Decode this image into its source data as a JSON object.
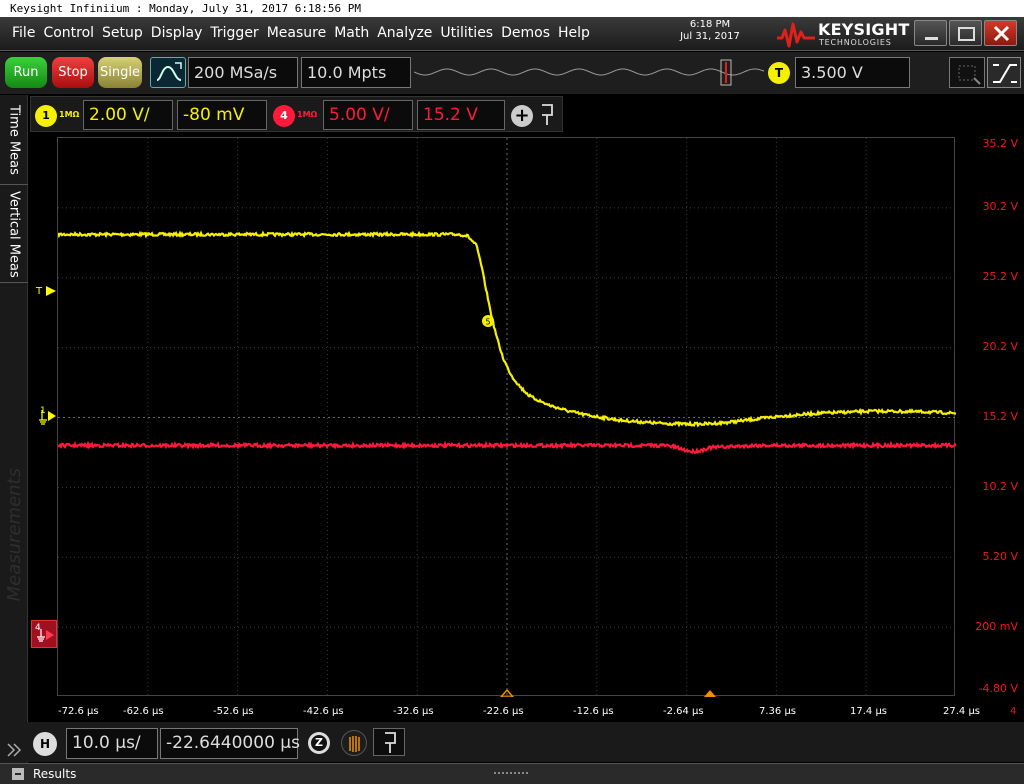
{
  "window": {
    "title": "Keysight Infiniium : Monday, July 31, 2017 6:18:56 PM"
  },
  "menu": [
    "File",
    "Control",
    "Setup",
    "Display",
    "Trigger",
    "Measure",
    "Math",
    "Analyze",
    "Utilities",
    "Demos",
    "Help"
  ],
  "clock": {
    "time": "6:18 PM",
    "date": "Jul 31, 2017"
  },
  "brand": {
    "name": "KEYSIGHT",
    "sub": "TECHNOLOGIES",
    "color": "#e0201a"
  },
  "controls": {
    "run": "Run",
    "stop": "Stop",
    "single": "Single"
  },
  "acquisition": {
    "sample_rate": "200 MSa/s",
    "memory_depth": "10.0 Mpts"
  },
  "trigger": {
    "badge": "T",
    "level": "3.500 V"
  },
  "tabs": {
    "time_meas": "Time Meas",
    "vertical_meas": "Vertical Meas",
    "measurements": "Measurements"
  },
  "channels": [
    {
      "number": "1",
      "impedance": "1MΩ",
      "scale": "2.00 V/",
      "offset": "-80 mV",
      "color": "#f5f000"
    },
    {
      "number": "4",
      "impedance": "1MΩ",
      "scale": "5.00 V/",
      "offset": "15.2 V",
      "color": "#ff1a3c"
    }
  ],
  "channel_bar_extra": {
    "add": "+"
  },
  "right_axis": {
    "labels": [
      "35.2 V",
      "30.2 V",
      "25.2 V",
      "20.2 V",
      "15.2 V",
      "10.2 V",
      "5.20 V",
      "200 mV",
      "-4.80 V"
    ]
  },
  "time_axis": {
    "labels": [
      "-72.6 µs",
      "-62.6 µs",
      "-52.6 µs",
      "-42.6 µs",
      "-32.6 µs",
      "-22.6 µs",
      "-12.6 µs",
      "-2.64 µs",
      "7.36 µs",
      "17.4 µs",
      "27.4 µs"
    ],
    "channel_tag": "4"
  },
  "markers": {
    "trigger": "T",
    "ground": "1",
    "channel4": "4",
    "marker5": "5"
  },
  "timebase": {
    "badge": "H",
    "scale": "10.0 µs/",
    "position": "-22.6440000 µs",
    "zoom": "Z"
  },
  "footer": {
    "results": "Results"
  },
  "chart_data": {
    "type": "line",
    "xlabel": "",
    "ylabel": "",
    "xlim": [
      -72.6,
      27.4
    ],
    "x_units": "µs",
    "grid": true,
    "series": [
      {
        "color": "#f5f000",
        "x": [
          -72.6,
          -60,
          -45,
          -35,
          -28,
          -27,
          -26,
          -25.5,
          -25,
          -24.5,
          -24,
          -23.5,
          -23,
          -22.5,
          -22,
          -21,
          -20,
          -18,
          -16,
          -14,
          -12,
          -10,
          -8,
          -6,
          -4,
          -2,
          0,
          2,
          4,
          6,
          8,
          10,
          12,
          14,
          16,
          18,
          20,
          22,
          24,
          26,
          27.4
        ],
        "y": [
          28.3,
          28.3,
          28.3,
          28.3,
          28.3,
          28.2,
          27.5,
          26.2,
          24.6,
          23.0,
          21.6,
          20.4,
          19.4,
          18.7,
          18.1,
          17.3,
          16.7,
          16.1,
          15.7,
          15.4,
          15.2,
          15.0,
          14.9,
          14.8,
          14.75,
          14.72,
          14.75,
          14.85,
          15.0,
          15.15,
          15.3,
          15.4,
          15.5,
          15.55,
          15.6,
          15.65,
          15.65,
          15.62,
          15.6,
          15.55,
          15.5
        ]
      },
      {
        "color": "#ff1a3c",
        "x": [
          -72.6,
          -40,
          -10,
          -5,
          -4,
          -3,
          -2,
          -1,
          0,
          5,
          15,
          27.4
        ],
        "y": [
          13.2,
          13.2,
          13.2,
          13.2,
          13.1,
          12.9,
          12.75,
          12.85,
          13.05,
          13.2,
          13.2,
          13.2
        ]
      }
    ]
  }
}
